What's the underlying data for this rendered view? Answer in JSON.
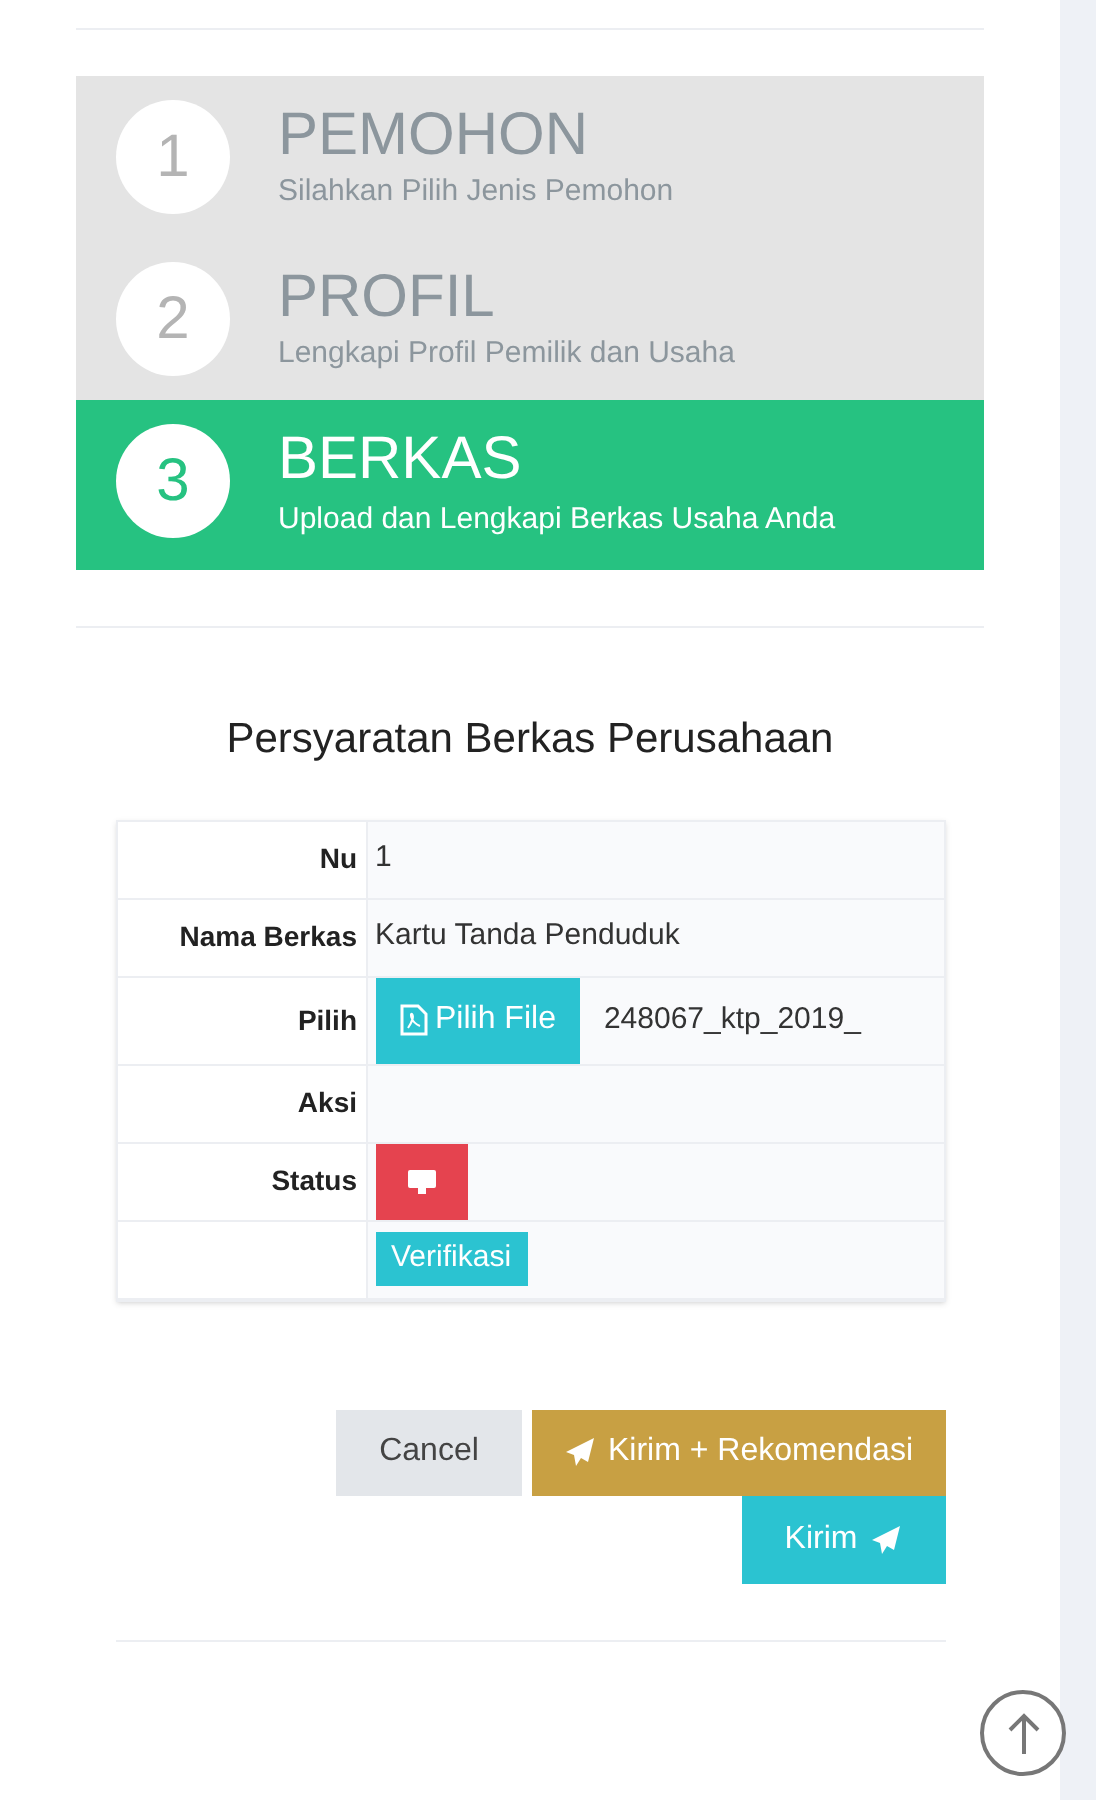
{
  "steps": [
    {
      "number": "1",
      "title": "PEMOHON",
      "subtitle": "Silahkan Pilih Jenis Pemohon",
      "selected": false
    },
    {
      "number": "2",
      "title": "PROFIL",
      "subtitle": "Lengkapi Profil Pemilik dan Usaha",
      "selected": false
    },
    {
      "number": "3",
      "title": "BERKAS",
      "subtitle": "Upload dan Lengkapi Berkas Usaha Anda",
      "selected": true
    }
  ],
  "section_title": "Persyaratan Berkas Perusahaan",
  "table": {
    "rows": [
      {
        "kind": "text",
        "label": "Nu",
        "value": "1"
      },
      {
        "kind": "text",
        "label": "Nama Berkas",
        "value": "Kartu Tanda Penduduk"
      },
      {
        "kind": "file",
        "label": "Pilih",
        "button": "Pilih File",
        "value": "248067_ktp_2019_"
      },
      {
        "kind": "empty",
        "label": "Aksi"
      },
      {
        "kind": "action",
        "label": "Status"
      },
      {
        "kind": "badge",
        "value": "Verifikasi"
      }
    ]
  },
  "buttons": {
    "cancel": "Cancel",
    "recommend": "Kirim + Rekomendasi",
    "send": "Kirim"
  }
}
